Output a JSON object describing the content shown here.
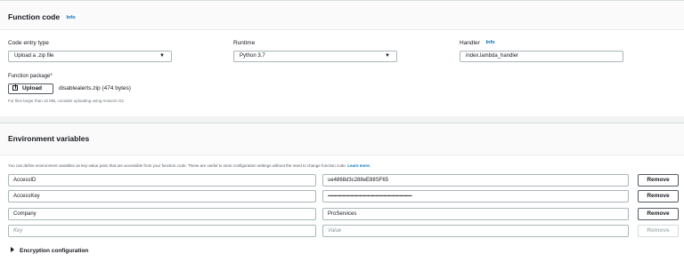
{
  "function_code": {
    "title": "Function code",
    "info": "Info",
    "code_entry_type": {
      "label": "Code entry type",
      "value": "Upload a .zip file"
    },
    "runtime": {
      "label": "Runtime",
      "value": "Python 3.7"
    },
    "handler": {
      "label": "Handler",
      "info": "Info",
      "value": "index.lambda_handler"
    },
    "function_package": {
      "label": "Function package*",
      "upload_label": "Upload",
      "file_name": "disablealerts.zip (474 bytes)",
      "hint": "For files larger than 10 MB, consider uploading using Amazon S3."
    }
  },
  "environment_variables": {
    "title": "Environment variables",
    "description": "You can define environment variables as key-value pairs that are accessible from your function code. These are useful to store configuration settings without the need to change function code.",
    "learn_more": "Learn more.",
    "rows": [
      {
        "key": "AccessID",
        "value": "ue4868d3c288eE88SF65",
        "remove": "Remove"
      },
      {
        "key": "AccessKey",
        "value": "••••••••••••••••••••••••••••••••••••••••••••••••••••••••••••••••••••••••••",
        "remove": "Remove"
      },
      {
        "key": "Company",
        "value": "ProServices",
        "remove": "Remove"
      }
    ],
    "new_row": {
      "key_placeholder": "Key",
      "value_placeholder": "Value",
      "remove": "Remove"
    },
    "encryption": "Encryption configuration"
  }
}
